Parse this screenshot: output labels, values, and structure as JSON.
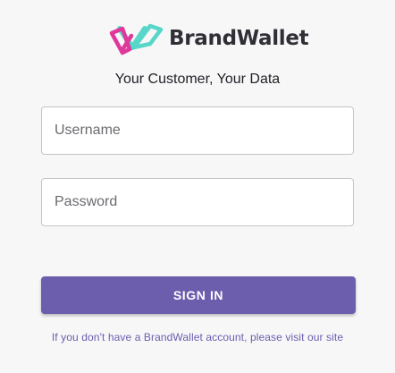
{
  "brand": {
    "name": "BrandWallet",
    "logo_icon": "brandwallet-logo-icon",
    "colors": {
      "pink": "#e0379b",
      "teal": "#57d6c9",
      "text": "#2f2f36"
    }
  },
  "tagline": "Your Customer, Your Data",
  "form": {
    "username_placeholder": "Username",
    "password_placeholder": "Password",
    "signin_label": "SIGN IN",
    "button_color": "#6c5dad"
  },
  "footer": {
    "text": "If you don't have a BrandWallet account, please visit our site",
    "link_color": "#6c5dad"
  }
}
